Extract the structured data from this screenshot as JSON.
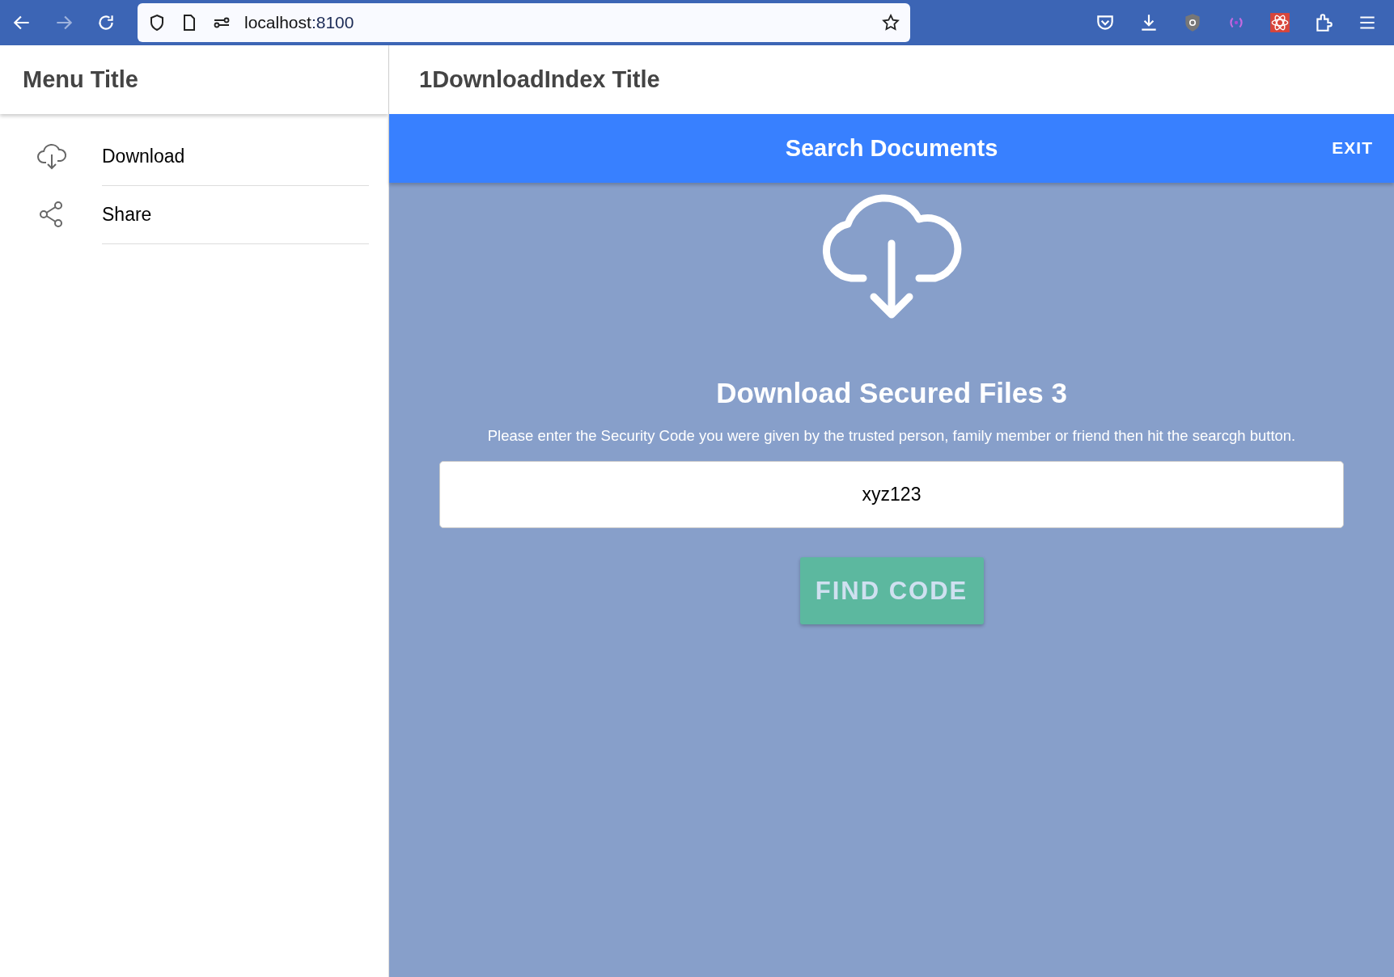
{
  "browser": {
    "url_host": "localhost",
    "url_port": ":8100"
  },
  "menu": {
    "title": "Menu Title",
    "items": [
      {
        "label": "Download",
        "kind": "download"
      },
      {
        "label": "Share",
        "kind": "share"
      }
    ]
  },
  "page": {
    "title": "1DownloadIndex Title"
  },
  "toolbar": {
    "title": "Search Documents",
    "exit": "EXIT"
  },
  "content": {
    "heading": "Download Secured Files 3",
    "instructions": "Please enter the Security Code you were given by the trusted person, family member or friend then hit the searcgh button.",
    "code_value": "xyz123",
    "button": "FIND CODE"
  }
}
